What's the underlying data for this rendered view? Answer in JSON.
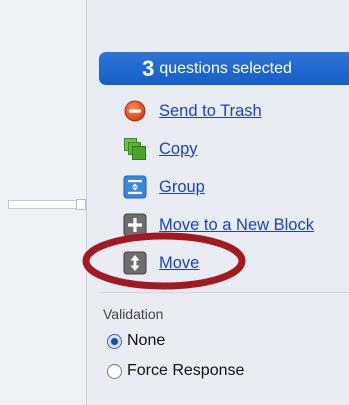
{
  "selection": {
    "count": "3",
    "label": "questions selected"
  },
  "actions": [
    {
      "label": "Send to Trash",
      "icon": "trash-icon"
    },
    {
      "label": "Copy",
      "icon": "copy-icon"
    },
    {
      "label": "Group",
      "icon": "group-icon"
    },
    {
      "label": "Move to a New Block",
      "icon": "new-block-icon"
    },
    {
      "label": "Move",
      "icon": "move-icon"
    }
  ],
  "validation": {
    "label": "Validation",
    "options": [
      {
        "label": "None",
        "checked": true
      },
      {
        "label": "Force Response",
        "checked": false
      }
    ]
  },
  "colors": {
    "accent": "#1a62cf",
    "link": "#1a3fcc",
    "highlight": "#a3191f"
  }
}
